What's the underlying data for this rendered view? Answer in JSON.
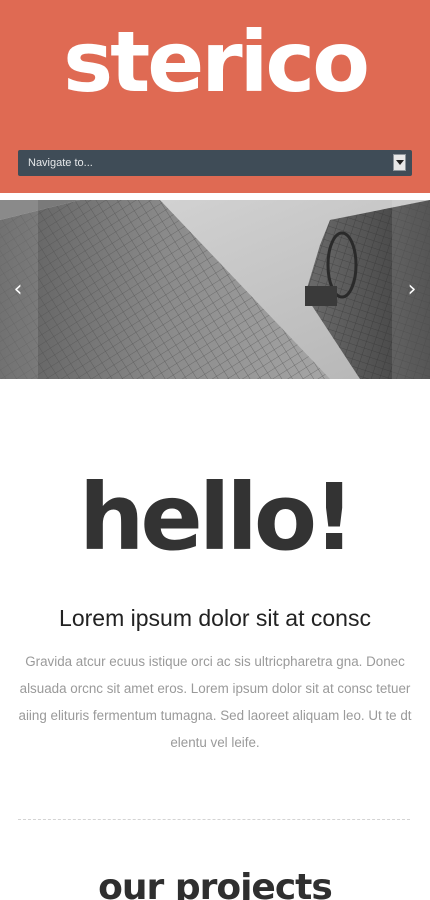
{
  "header": {
    "logo_text": "sterico",
    "background_color": "#df6a53",
    "nav": {
      "selected_label": "Navigate to...",
      "background_color": "#3f4c57"
    }
  },
  "slider": {
    "image": "grayscale skyscrapers photo",
    "prev_icon": "chevron-left-icon",
    "next_icon": "chevron-right-icon"
  },
  "intro": {
    "heading": "hello!",
    "subtitle": "Lorem ipsum dolor sit at consc",
    "body": "Gravida atcur ecuus istique orci ac sis ultricpharetra gna. Donec alsuada orcnc sit amet eros. Lorem ipsum dolor sit at consc tetuer aiing elituris fermentum tumagna. Sed laoreet aliquam leo. Ut te dt elentu vel leife."
  },
  "projects": {
    "title": "our projects"
  }
}
